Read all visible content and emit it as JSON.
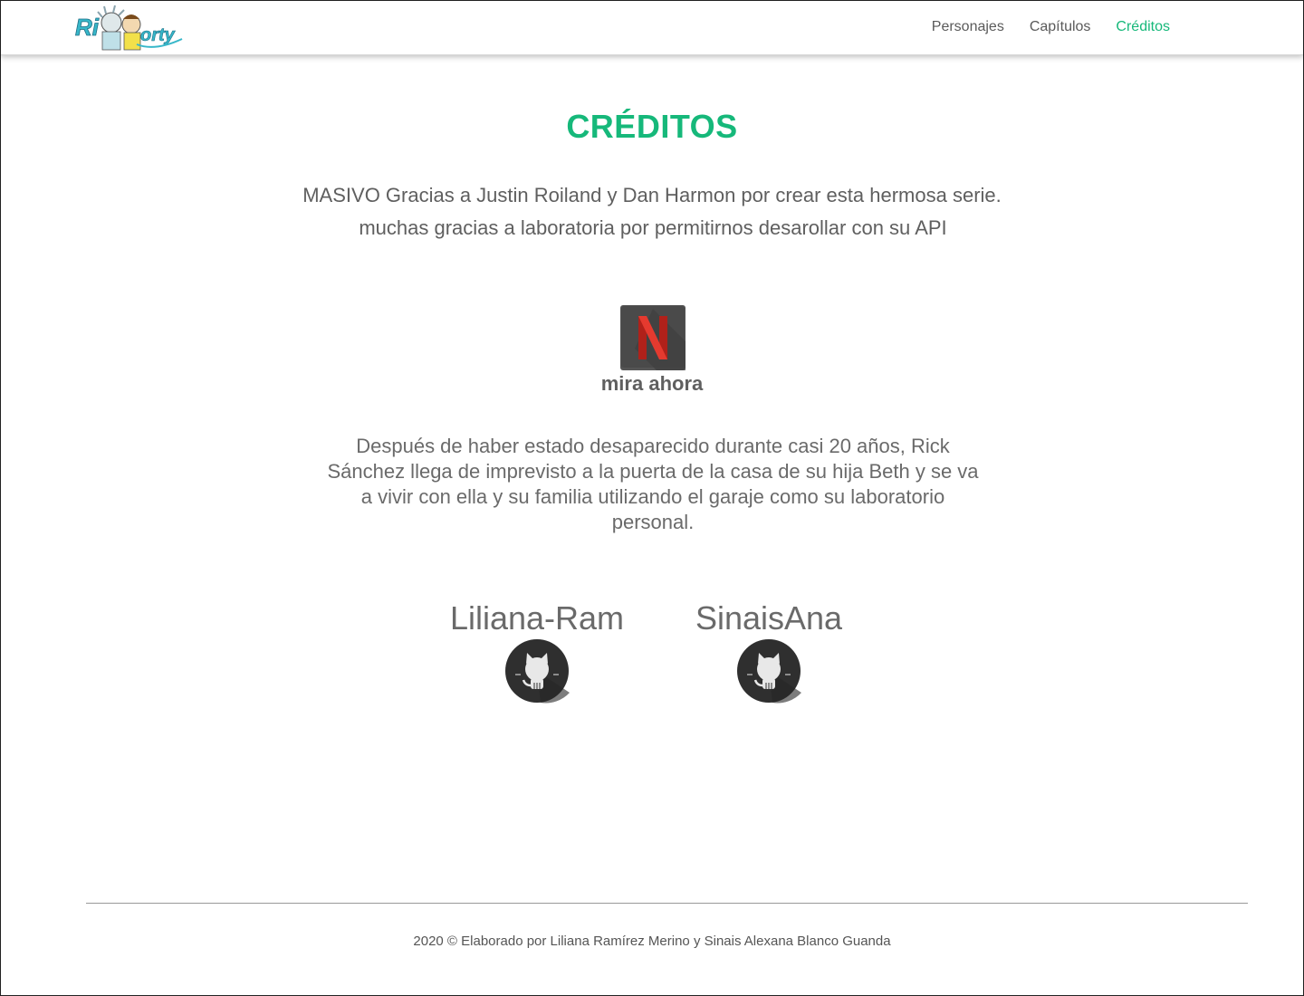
{
  "header": {
    "logo_text": "Rick and Morty",
    "nav": [
      {
        "label": "Personajes",
        "active": false
      },
      {
        "label": "Capítulos",
        "active": false
      },
      {
        "label": "Créditos",
        "active": true
      }
    ]
  },
  "colors": {
    "accent": "#16b87a",
    "text": "#5f5f5f",
    "netflix_red": "#d6281e",
    "netflix_bg": "#4a4a4a",
    "github_bg": "#2f2f2f"
  },
  "main": {
    "title": "CRÉDITOS",
    "thanks_line1": "MASIVO Gracias a Justin Roiland y Dan Harmon por crear esta hermosa serie.",
    "thanks_line2": "muchas gracias a laboratoria por permitirnos desarollar con su API",
    "netflix_icon": "netflix-icon",
    "watch_label": "mira ahora",
    "description": "Después de haber estado desaparecido durante casi 20 años, Rick Sánchez llega de imprevisto a la puerta de la casa de su hija Beth y se va a vivir con ella y su familia utilizando el garaje como su laboratorio personal.",
    "authors": [
      {
        "name": "Liliana-Ram",
        "icon": "github-icon"
      },
      {
        "name": "SinaisAna",
        "icon": "github-icon"
      }
    ]
  },
  "footer": {
    "text": "2020 © Elaborado por Liliana Ramírez Merino y Sinais Alexana Blanco Guanda"
  }
}
